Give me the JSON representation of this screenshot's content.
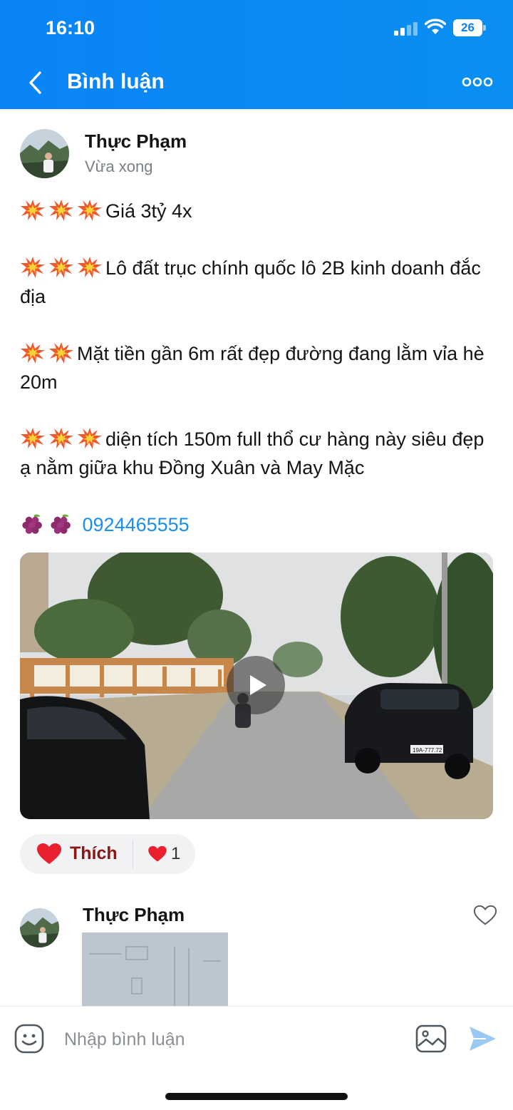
{
  "status_bar": {
    "time": "16:10",
    "battery": "26"
  },
  "header": {
    "title": "Bình luận"
  },
  "post": {
    "author": "Thực Phạm",
    "time": "Vừa xong",
    "lines": [
      "Giá 3tỷ 4x",
      "Lô đất trục chính quốc lô 2B kinh doanh đắc địa",
      "Mặt tiền gần 6m rất đẹp đường đang lằm vỉa hè 20m",
      "diện tích 150m full thổ cư hàng này siêu đẹp ạ nằm giữa khu Đồng Xuân và May Mặc"
    ],
    "phone": "0924465555",
    "video": {
      "plate": "19A-777.72"
    },
    "like_label": "Thích",
    "like_count": "1"
  },
  "comment": {
    "author": "Thực Phạm"
  },
  "input": {
    "placeholder": "Nhập bình luận"
  },
  "colors": {
    "header": "#0a84f5",
    "link": "#1a8ef0",
    "like_text": "#8c1515"
  },
  "icons": [
    "back-arrow-icon",
    "more-icon",
    "collision-emoji-icon",
    "grapes-emoji-icon",
    "play-icon",
    "heart-icon",
    "heart-outline-icon",
    "emoji-face-icon",
    "image-icon",
    "send-icon"
  ]
}
